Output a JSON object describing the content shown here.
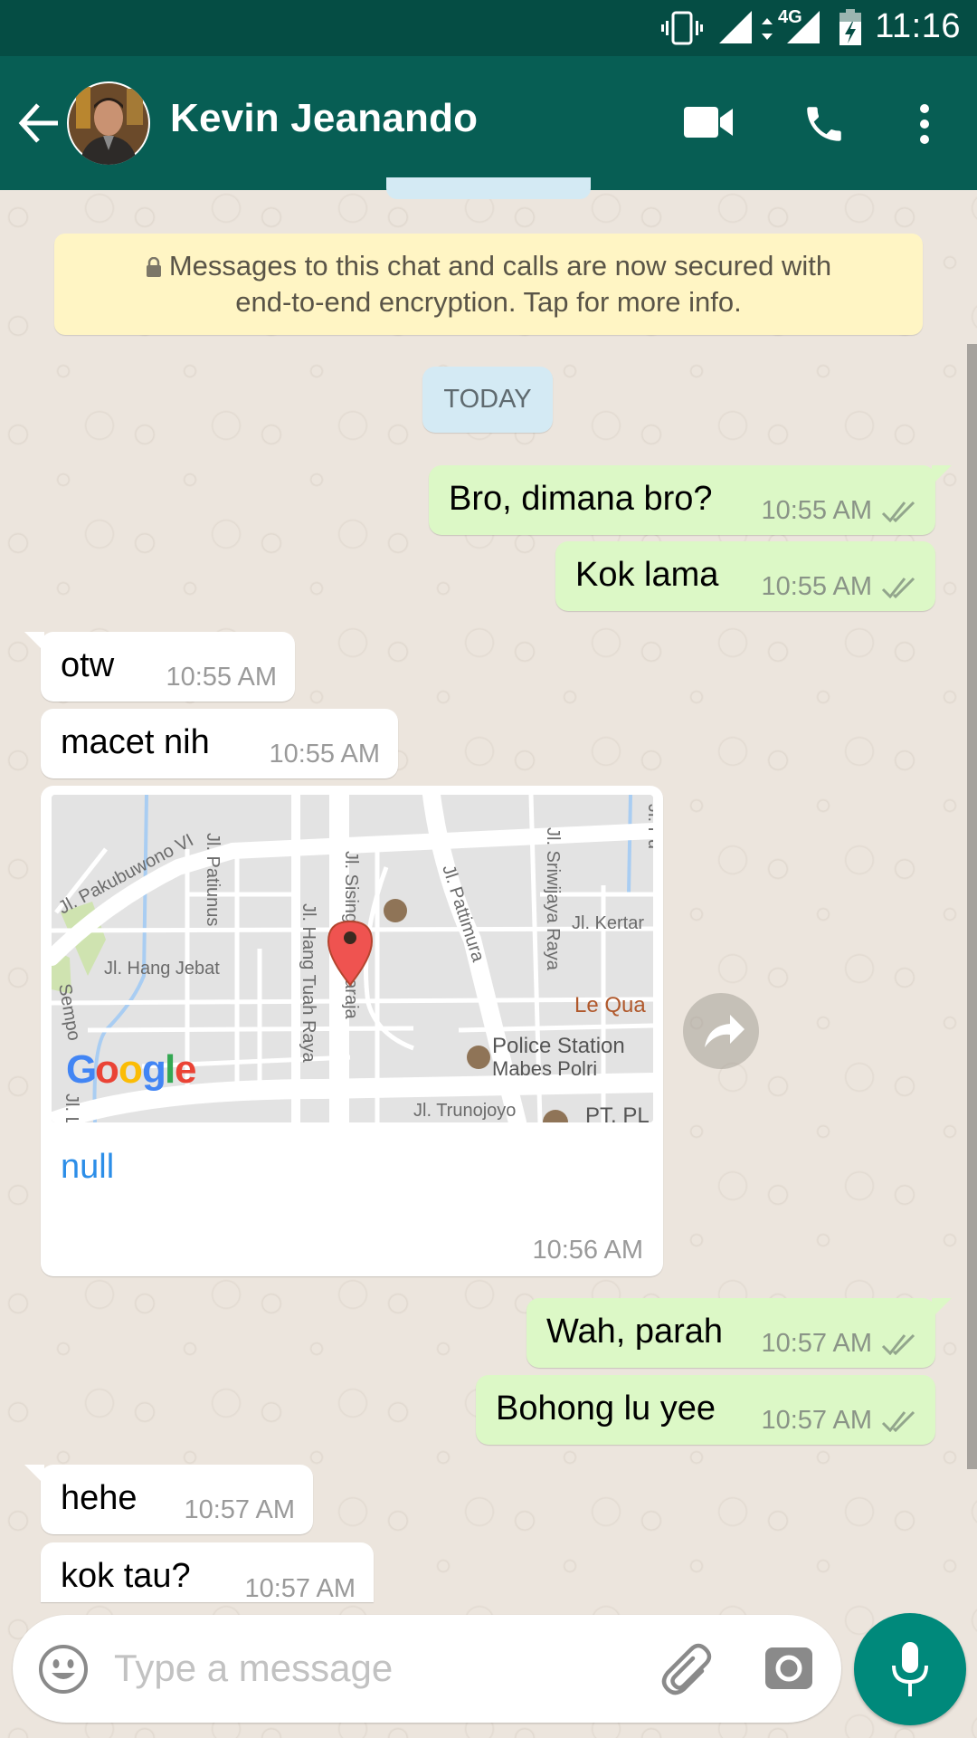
{
  "status_bar": {
    "time": "11:16",
    "network": "4G",
    "icons": [
      "vibrate-icon",
      "signal-icon",
      "data-activity-icon",
      "signal-4g-icon",
      "battery-charging-icon"
    ]
  },
  "header": {
    "contact_name": "Kevin Jeanando",
    "icons": [
      "back-arrow-icon",
      "avatar",
      "video-call-icon",
      "voice-call-icon",
      "more-vert-icon"
    ]
  },
  "encryption_notice": {
    "line1": "Messages to this chat and calls are now secured with",
    "line2": "end-to-end encryption. Tap for more info."
  },
  "date_chip": "TODAY",
  "messages": [
    {
      "direction": "out",
      "text": "Bro, dimana bro?",
      "time": "10:55 AM",
      "status": "delivered"
    },
    {
      "direction": "out",
      "text": "Kok lama",
      "time": "10:55 AM",
      "status": "delivered"
    },
    {
      "direction": "in",
      "text": "otw",
      "time": "10:55 AM"
    },
    {
      "direction": "in",
      "text": "macet nih",
      "time": "10:55 AM"
    },
    {
      "direction": "in",
      "type": "location",
      "link_text": "null",
      "time": "10:56 AM",
      "map_labels": {
        "streets": [
          "Jl. Pakubuwono VI",
          "Jl. Patiunus",
          "Jl. Hang Tuah Raya",
          "Jl. Sisingamangaraja",
          "Jl. Pattimura",
          "Jl. Sriwijaya Raya",
          "Jl. Kertanegara",
          "Jl. Hang Jebat",
          "Jl. Trunojoyo",
          "Jl. Pudjangga",
          "Jl. Sempo",
          "Jl. La"
        ],
        "places": [
          "Police Station",
          "Mabes Polri",
          "Le Qua",
          "PT. PL"
        ],
        "logo": "Google"
      }
    },
    {
      "direction": "out",
      "text": "Wah, parah",
      "time": "10:57 AM",
      "status": "delivered"
    },
    {
      "direction": "out",
      "text": "Bohong lu yee",
      "time": "10:57 AM",
      "status": "delivered"
    },
    {
      "direction": "in",
      "text": "hehe",
      "time": "10:57 AM"
    },
    {
      "direction": "in",
      "text": "kok tau?",
      "time": "10:57 AM"
    }
  ],
  "composer": {
    "placeholder": "Type a message",
    "value": ""
  },
  "colors": {
    "status_bar": "#054d44",
    "header": "#075e54",
    "outgoing_bubble": "#dcf8c6",
    "incoming_bubble": "#ffffff",
    "chat_background": "#ece5dd",
    "mic_button": "#00897b",
    "link": "#2c8ee8"
  }
}
